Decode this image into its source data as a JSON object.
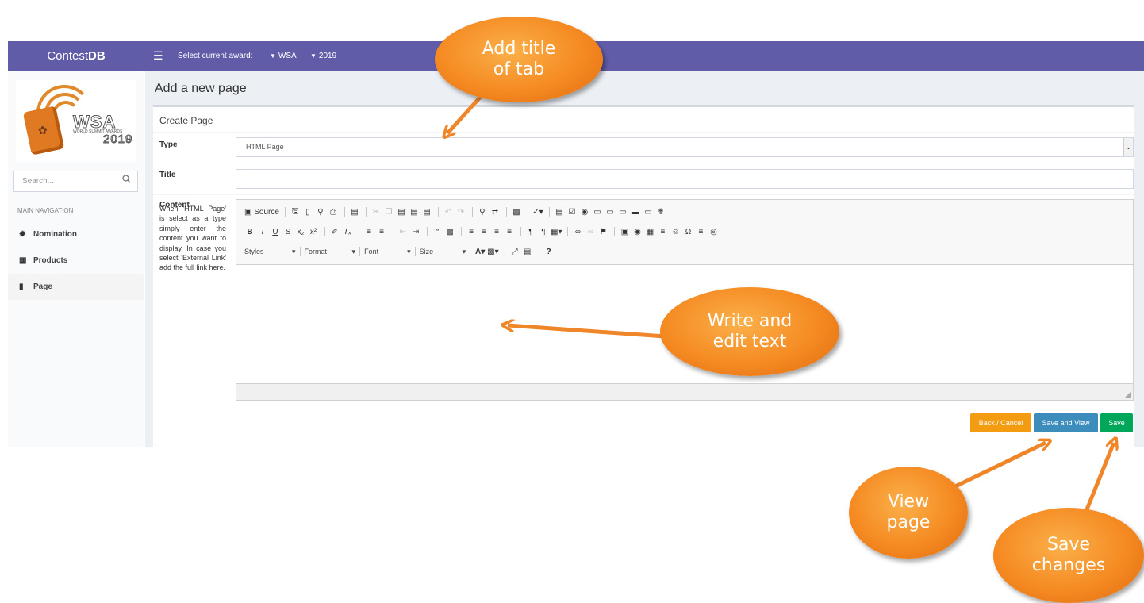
{
  "topbar": {
    "brand_plain": "Contest",
    "brand_bold": "DB",
    "menu_icon": "hamburger-icon",
    "award_label": "Select current award:",
    "award_value": "WSA",
    "year_value": "2019"
  },
  "sidebar": {
    "logo": {
      "wsa": "WSA",
      "sub": "WORLD SUMMIT AWARDS",
      "year": "2019"
    },
    "search": {
      "placeholder": "Search...",
      "icon": "search-icon"
    },
    "nav_header": "MAIN NAVIGATION",
    "items": [
      {
        "label": "Nomination",
        "icon": "gear-icon"
      },
      {
        "label": "Products",
        "icon": "sitemap-icon"
      },
      {
        "label": "Page",
        "icon": "file-icon"
      }
    ]
  },
  "main": {
    "page_title": "Add a new page",
    "box_title": "Create Page",
    "type_label": "Type",
    "type_value": "HTML Page",
    "title_label": "Title",
    "title_value": "",
    "content_label": "Content",
    "help_text": "When 'HTML Page' is select as a type simply enter the content you want to display. In case you select 'External Link' add the full link here.",
    "editor": {
      "source_label": "Source",
      "styles_label": "Styles",
      "format_label": "Format",
      "font_label": "Font",
      "size_label": "Size"
    },
    "buttons": {
      "back": "Back / Cancel",
      "save_view": "Save and View",
      "save": "Save"
    }
  },
  "callouts": {
    "title_tab": [
      "Add title",
      "of tab"
    ],
    "write_edit": [
      "Write and",
      "edit text"
    ],
    "view_page": [
      "View",
      "page"
    ],
    "save_changes": [
      "Save",
      "changes"
    ]
  },
  "colors": {
    "topbar": "#605ca8",
    "callout": "#f58a22",
    "back_button": "#f39c12",
    "view_button": "#3c8dbc",
    "save_button": "#00a65a"
  }
}
